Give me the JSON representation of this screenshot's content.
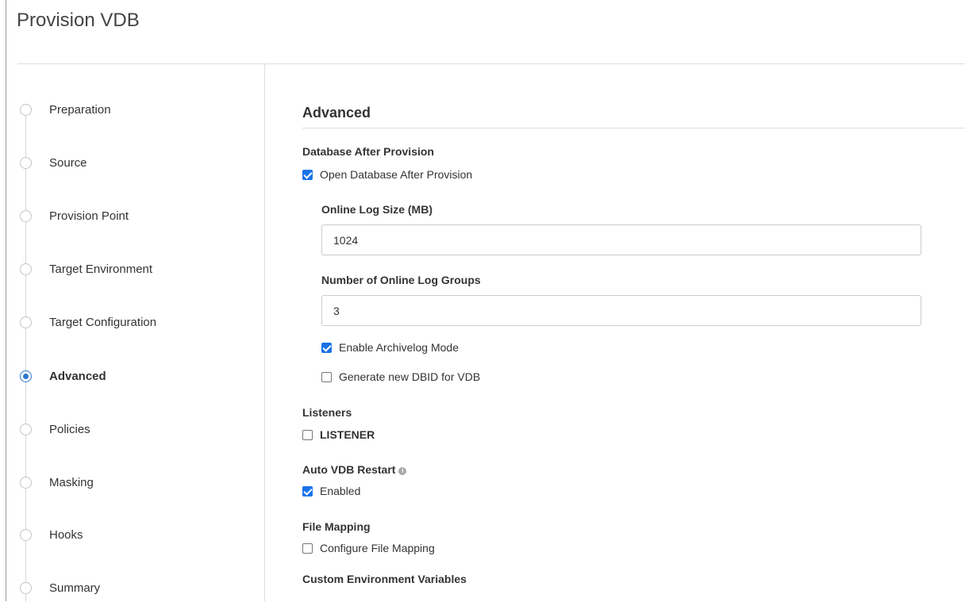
{
  "dialog": {
    "title": "Provision VDB"
  },
  "steps": [
    {
      "label": "Preparation",
      "active": false
    },
    {
      "label": "Source",
      "active": false
    },
    {
      "label": "Provision Point",
      "active": false
    },
    {
      "label": "Target Environment",
      "active": false
    },
    {
      "label": "Target Configuration",
      "active": false
    },
    {
      "label": "Advanced",
      "active": true
    },
    {
      "label": "Policies",
      "active": false
    },
    {
      "label": "Masking",
      "active": false
    },
    {
      "label": "Hooks",
      "active": false
    },
    {
      "label": "Summary",
      "active": false
    }
  ],
  "advanced": {
    "title": "Advanced",
    "database_after_provision": {
      "heading": "Database After Provision",
      "open_db_label": "Open Database After Provision",
      "open_db_checked": true,
      "online_log_size_label": "Online Log Size (MB)",
      "online_log_size_value": "1024",
      "log_groups_label": "Number of Online Log Groups",
      "log_groups_value": "3",
      "archivelog_label": "Enable Archivelog Mode",
      "archivelog_checked": true,
      "new_dbid_label": "Generate new DBID for VDB",
      "new_dbid_checked": false
    },
    "listeners": {
      "heading": "Listeners",
      "listener_label": "LISTENER",
      "listener_checked": false
    },
    "auto_restart": {
      "heading": "Auto VDB Restart",
      "info_icon": "info-icon",
      "enabled_label": "Enabled",
      "enabled_checked": true
    },
    "file_mapping": {
      "heading": "File Mapping",
      "configure_label": "Configure File Mapping",
      "configure_checked": false
    },
    "custom_env": {
      "heading": "Custom Environment Variables"
    }
  },
  "colors": {
    "accent": "#2a76d2",
    "checkbox_checked": "#1a73e8",
    "divider": "#dddddd"
  }
}
